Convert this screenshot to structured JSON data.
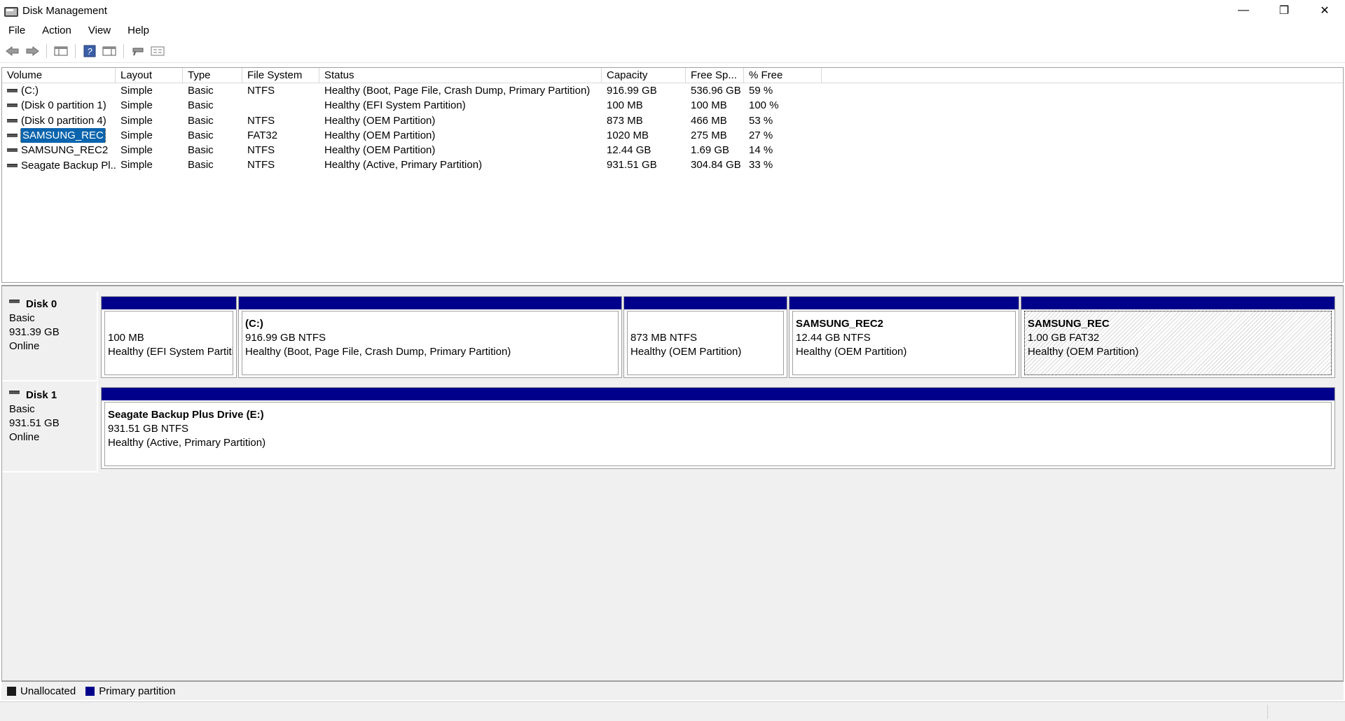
{
  "window": {
    "title": "Disk Management",
    "controls": {
      "minimize": "—",
      "restore": "❐",
      "close": "✕"
    }
  },
  "menu": [
    "File",
    "Action",
    "View",
    "Help"
  ],
  "toolbar": {
    "icons": [
      "back-arrow-icon",
      "forward-arrow-icon",
      "console-tree-icon",
      "help-icon",
      "action-pane-icon",
      "connect-icon",
      "properties-icon"
    ]
  },
  "volumes": {
    "headers": [
      "Volume",
      "Layout",
      "Type",
      "File System",
      "Status",
      "Capacity",
      "Free Sp...",
      "% Free"
    ],
    "rows": [
      {
        "volume": "(C:)",
        "layout": "Simple",
        "type": "Basic",
        "fs": "NTFS",
        "status": "Healthy (Boot, Page File, Crash Dump, Primary Partition)",
        "capacity": "916.99 GB",
        "free": "536.96 GB",
        "pct": "59 %"
      },
      {
        "volume": "(Disk 0 partition 1)",
        "layout": "Simple",
        "type": "Basic",
        "fs": "",
        "status": "Healthy (EFI System Partition)",
        "capacity": "100 MB",
        "free": "100 MB",
        "pct": "100 %"
      },
      {
        "volume": "(Disk 0 partition 4)",
        "layout": "Simple",
        "type": "Basic",
        "fs": "NTFS",
        "status": "Healthy (OEM Partition)",
        "capacity": "873 MB",
        "free": "466 MB",
        "pct": "53 %"
      },
      {
        "volume": "SAMSUNG_REC",
        "layout": "Simple",
        "type": "Basic",
        "fs": "FAT32",
        "status": "Healthy (OEM Partition)",
        "capacity": "1020 MB",
        "free": "275 MB",
        "pct": "27 %"
      },
      {
        "volume": "SAMSUNG_REC2",
        "layout": "Simple",
        "type": "Basic",
        "fs": "NTFS",
        "status": "Healthy (OEM Partition)",
        "capacity": "12.44 GB",
        "free": "1.69 GB",
        "pct": "14 %"
      },
      {
        "volume": "Seagate Backup Pl...",
        "layout": "Simple",
        "type": "Basic",
        "fs": "NTFS",
        "status": "Healthy (Active, Primary Partition)",
        "capacity": "931.51 GB",
        "free": "304.84 GB",
        "pct": "33 %"
      }
    ],
    "selected_index": 3
  },
  "disks": [
    {
      "name": "Disk 0",
      "type": "Basic",
      "size": "931.39 GB",
      "state": "Online",
      "partitions": [
        {
          "name": "",
          "size": "100 MB",
          "status": "Healthy (EFI System Partition)"
        },
        {
          "name": "(C:)",
          "size": "916.99 GB NTFS",
          "status": "Healthy (Boot, Page File, Crash Dump, Primary Partition)"
        },
        {
          "name": "",
          "size": "873 MB NTFS",
          "status": "Healthy (OEM Partition)"
        },
        {
          "name": "SAMSUNG_REC2",
          "size": "12.44 GB NTFS",
          "status": "Healthy (OEM Partition)"
        },
        {
          "name": "SAMSUNG_REC",
          "size": "1.00 GB FAT32",
          "status": "Healthy (OEM Partition)"
        }
      ]
    },
    {
      "name": "Disk 1",
      "type": "Basic",
      "size": "931.51 GB",
      "state": "Online",
      "partitions": [
        {
          "name": "Seagate Backup Plus Drive  (E:)",
          "size": "931.51 GB NTFS",
          "status": "Healthy (Active, Primary Partition)"
        }
      ]
    }
  ],
  "legend": [
    {
      "label": "Unallocated",
      "color": "#1a1a1a"
    },
    {
      "label": "Primary partition",
      "color": "#00008b"
    }
  ]
}
